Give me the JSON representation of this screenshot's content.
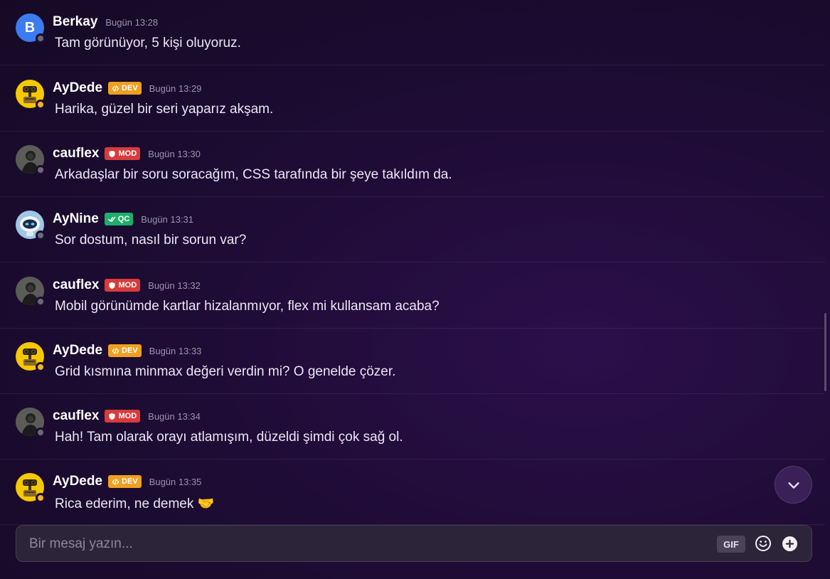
{
  "messages": [
    {
      "user": "Berkay",
      "badge": null,
      "time": "Bugün 13:28",
      "text": "Tam görünüyor, 5 kişi oluyoruz.",
      "avatar": "letter",
      "avatar_letter": "B",
      "status": "offline"
    },
    {
      "user": "AyDede",
      "badge": "DEV",
      "time": "Bugün 13:29",
      "text": "Harika, güzel bir seri yaparız akşam.",
      "avatar": "robot-yellow",
      "status": "idle"
    },
    {
      "user": "cauflex",
      "badge": "MOD",
      "time": "Bugün 13:30",
      "text": "Arkadaşlar bir soru soracağım, CSS tarafında bir şeye takıldım da.",
      "avatar": "photo",
      "status": "offline"
    },
    {
      "user": "AyNine",
      "badge": "QC",
      "time": "Bugün 13:31",
      "text": "Sor dostum, nasıl bir sorun var?",
      "avatar": "robot-blue",
      "status": "offline"
    },
    {
      "user": "cauflex",
      "badge": "MOD",
      "time": "Bugün 13:32",
      "text": "Mobil görünümde kartlar hizalanmıyor, flex mi kullansam acaba?",
      "avatar": "photo",
      "status": "offline"
    },
    {
      "user": "AyDede",
      "badge": "DEV",
      "time": "Bugün 13:33",
      "text": "Grid kısmına minmax değeri verdin mi? O genelde çözer.",
      "avatar": "robot-yellow",
      "status": "idle"
    },
    {
      "user": "cauflex",
      "badge": "MOD",
      "time": "Bugün 13:34",
      "text": "Hah! Tam olarak orayı atlamışım, düzeldi şimdi çok sağ ol.",
      "avatar": "photo",
      "status": "offline"
    },
    {
      "user": "AyDede",
      "badge": "DEV",
      "time": "Bugün 13:35",
      "text": "Rica ederim, ne demek 🤝",
      "avatar": "robot-yellow",
      "status": "idle"
    }
  ],
  "composer": {
    "placeholder": "Bir mesaj yazın...",
    "gif_label": "GIF"
  },
  "colors": {
    "dev_badge": "#f0a020",
    "mod_badge": "#d93b3b",
    "qc_badge": "#1fae6b",
    "letter_avatar": "#3d7bf0",
    "idle": "#f0b232",
    "offline": "#6d6a78"
  },
  "icons": {
    "scroll_down": "chevron-down-icon",
    "emoji": "smiley-icon",
    "add": "plus-icon"
  }
}
